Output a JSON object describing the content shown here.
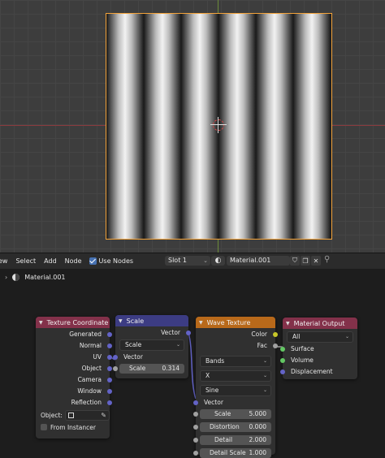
{
  "header": {
    "menus": [
      "ew",
      "Select",
      "Add",
      "Node"
    ],
    "use_nodes_label": "Use Nodes",
    "slot": "Slot 1",
    "material_name": "Material.001"
  },
  "breadcrumb": {
    "label": "Material.001"
  },
  "nodes": {
    "texture_coordinate": {
      "title": "Texture Coordinate",
      "outputs": [
        "Generated",
        "Normal",
        "UV",
        "Object",
        "Camera",
        "Window",
        "Reflection"
      ],
      "object_label": "Object:",
      "from_instancer": "From Instancer"
    },
    "scale": {
      "title": "Scale",
      "output": "Vector",
      "mode": "Scale",
      "input_vector": "Vector",
      "scale_label": "Scale",
      "scale_value": "0.314"
    },
    "wave_texture": {
      "title": "Wave Texture",
      "outputs": [
        "Color",
        "Fac"
      ],
      "wave_type": "Bands",
      "direction": "X",
      "profile": "Sine",
      "input_vector": "Vector",
      "params": [
        {
          "label": "Scale",
          "value": "5.000"
        },
        {
          "label": "Distortion",
          "value": "0.000"
        },
        {
          "label": "Detail",
          "value": "2.000"
        },
        {
          "label": "Detail Scale",
          "value": "1.000"
        }
      ]
    },
    "material_output": {
      "title": "Material Output",
      "target": "All",
      "inputs": [
        "Surface",
        "Volume",
        "Displacement"
      ]
    }
  },
  "colors": {
    "texture_coordinate_header": "#83314a",
    "scale_header": "#3c3c83",
    "wave_texture_header": "#b8691a",
    "material_output_header": "#83314a",
    "selection_outline": "#f3a33a"
  }
}
